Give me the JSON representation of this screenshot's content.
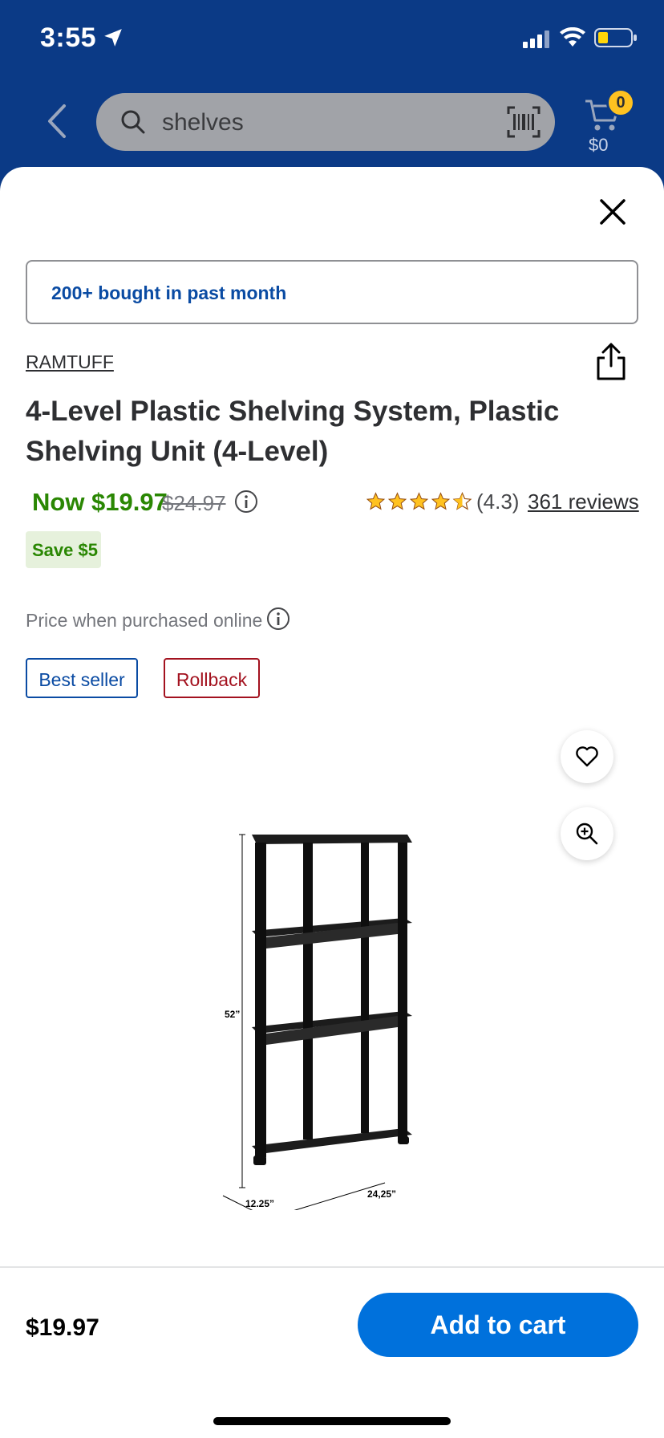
{
  "status": {
    "time": "3:55"
  },
  "header": {
    "search_text": "shelves",
    "cart_count": "0",
    "cart_amount": "$0"
  },
  "badges": {
    "bought": "200+ bought in past month"
  },
  "product": {
    "brand": "RAMTUFF",
    "title": "4-Level Plastic Shelving System, Plastic Shelving Unit (4-Level)",
    "price_now": "Now $19.97",
    "price_was": "$24.97",
    "rating_value": 4.3,
    "rating_text": "(4.3)",
    "reviews": "361 reviews",
    "save": "Save $5",
    "price_note": "Price when purchased online",
    "tags": {
      "best": "Best seller",
      "rollback": "Rollback"
    },
    "image_labels": {
      "height": "52”",
      "depth": "12.25”",
      "width": "24,25”"
    }
  },
  "footer": {
    "price": "$19.97",
    "add_to_cart": "Add to cart"
  },
  "colors": {
    "header_bg": "#0b3a86",
    "accent_blue": "#0071dc",
    "price_green": "#2a8703",
    "star": "#ffc220",
    "rollback_red": "#a3121f"
  }
}
